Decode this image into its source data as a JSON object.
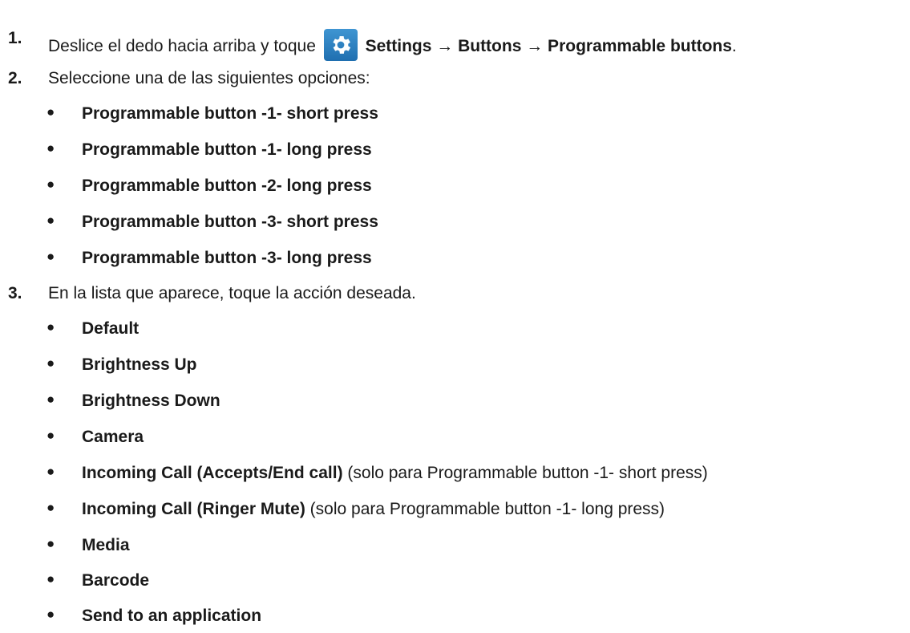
{
  "steps": [
    {
      "number": "1.",
      "text_before": "Deslice el dedo hacia arriba y toque",
      "icon": "settings-gear-icon",
      "path_bold": "Settings → Buttons → Programmable buttons",
      "text_after": "."
    },
    {
      "number": "2.",
      "text": "Seleccione una de las siguientes opciones:",
      "bullets": [
        {
          "bold": "Programmable button -1- short press"
        },
        {
          "bold": "Programmable button -1- long press"
        },
        {
          "bold": "Programmable button -2- long press"
        },
        {
          "bold": "Programmable button -3- short press"
        },
        {
          "bold": "Programmable button -3- long press"
        }
      ]
    },
    {
      "number": "3.",
      "text": "En la lista que aparece, toque la acción deseada.",
      "bullets": [
        {
          "bold": "Default"
        },
        {
          "bold": "Brightness Up"
        },
        {
          "bold": "Brightness Down"
        },
        {
          "bold": "Camera"
        },
        {
          "bold": "Incoming Call (Accepts/End call)",
          "note": " (solo para Programmable button -1- short press)"
        },
        {
          "bold": "Incoming Call (Ringer Mute)",
          "note": " (solo para Programmable button -1- long press)"
        },
        {
          "bold": "Media"
        },
        {
          "bold": "Barcode"
        },
        {
          "bold": "Send to an application"
        }
      ]
    }
  ],
  "bullet_glyph": "●",
  "colors": {
    "text": "#1a1a1a",
    "icon_bg": "#2a7fc0"
  }
}
